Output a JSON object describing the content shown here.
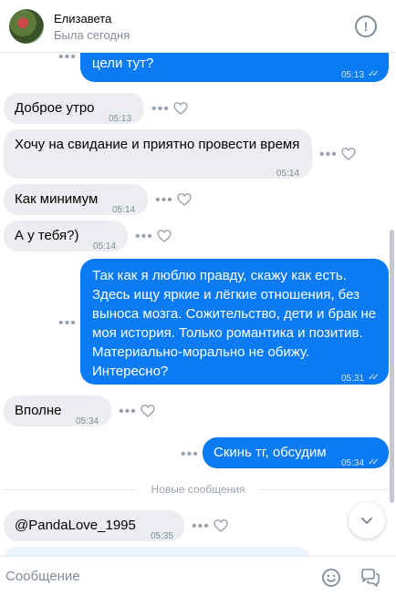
{
  "header": {
    "contact_name": "Елизавета",
    "contact_status": "Была сегодня",
    "info_glyph": "!"
  },
  "messages": [
    {
      "dir": "out",
      "text": "цели тут?",
      "time": "05:13",
      "read": true,
      "partially_hidden": true
    },
    {
      "dir": "in",
      "text": "Доброе утро",
      "time": "05:13"
    },
    {
      "dir": "in",
      "text": "Хочу на свидание и приятно провести время",
      "time": "05:14"
    },
    {
      "dir": "in",
      "text": "Как минимум",
      "time": "05:14"
    },
    {
      "dir": "in",
      "text": "А у тебя?)",
      "time": "05:14"
    },
    {
      "dir": "out",
      "lines": [
        "Так как я люблю правду, скажу как есть.",
        "Здесь ищу яркие и лёгкие отношения, без",
        "выноса мозга. Сожительство, дети и брак не",
        "моя история. Только романтика и позитив.",
        "Материально-морально не обижу.",
        "Интересно?"
      ],
      "time": "05:31",
      "read": true
    },
    {
      "dir": "in",
      "text": "Вполне",
      "time": "05:34"
    },
    {
      "dir": "out",
      "text": "Скинь тг, обсудим",
      "time": "05:34",
      "read": true
    },
    {
      "dir": "in",
      "text": "@PandaLove_1995",
      "time": "05:35"
    }
  ],
  "divider": {
    "label": "Новые сообщения"
  },
  "composer": {
    "placeholder": "Сообщение"
  },
  "icons": {
    "info": "info-icon",
    "more": "more-dots-icon",
    "like": "heart-icon",
    "read": "double-check-icon",
    "scroll_down": "chevron-down-icon",
    "emoji": "smile-icon",
    "voice": "chat-bubbles-icon"
  },
  "colors": {
    "outgoing_bubble": "#0a7bf2",
    "incoming_bubble": "#ebedf0",
    "secondary_text": "#818c99",
    "header_bg": "#ffffff"
  }
}
